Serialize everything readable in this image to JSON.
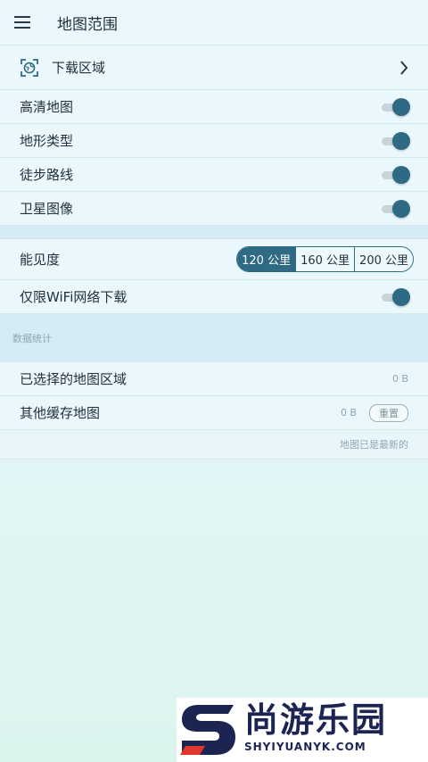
{
  "header": {
    "title": "地图范围"
  },
  "download_region": {
    "label": "下载区域"
  },
  "toggles": [
    {
      "label": "高清地图",
      "on": true
    },
    {
      "label": "地形类型",
      "on": true
    },
    {
      "label": "徒步路线",
      "on": true
    },
    {
      "label": "卫星图像",
      "on": true
    }
  ],
  "visibility": {
    "label": "能见度",
    "options": [
      "120 公里",
      "160 公里",
      "200 公里"
    ],
    "selected": "120 公里"
  },
  "wifi_only": {
    "label": "仅限WiFi网络下载",
    "on": true
  },
  "stats": {
    "header": "数据统计",
    "selected_region": {
      "label": "已选择的地图区域",
      "size": "0 B"
    },
    "other_cache": {
      "label": "其他缓存地图",
      "size": "0 B",
      "reset_label": "重置"
    },
    "status": "地图已是最新的"
  },
  "watermark": {
    "cn": "尚游乐园",
    "en": "SHYIYUANYK.COM"
  },
  "colors": {
    "accent": "#2e6a84",
    "background": "#e6f5fb",
    "section": "#d5ebf5"
  }
}
